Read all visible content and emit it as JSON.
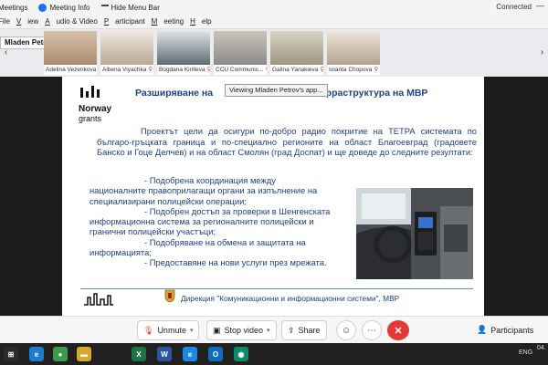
{
  "app": {
    "top_items": [
      {
        "label": "Meetings"
      },
      {
        "label": "Meeting Info"
      },
      {
        "label": "Hide Menu Bar"
      }
    ],
    "status": "Connected",
    "minimize": "—"
  },
  "menu": [
    {
      "label": "File",
      "underline_first": false
    },
    {
      "label": "View",
      "underline_first": true
    },
    {
      "label": "Audio & Video",
      "underline_first": true
    },
    {
      "label": "Participant",
      "underline_first": true
    },
    {
      "label": "Meeting",
      "underline_first": true
    },
    {
      "label": "Help",
      "underline_first": true
    }
  ],
  "presenter_label": "Mladen Petrov",
  "participants": [
    {
      "name": "Adelina Vezenkova",
      "color": "#c9b29a"
    },
    {
      "name": "Aibena Viyachka",
      "color": "#d8cfc3"
    },
    {
      "name": "Bogdana Kirilleva",
      "color": "#7c8a92"
    },
    {
      "name": "CCU Communic...",
      "color": "#b7b2a8"
    },
    {
      "name": "Galina Yanakieva",
      "color": "#c8c3b2"
    },
    {
      "name": "Iolanta Chopova",
      "color": "#d9ccbf"
    }
  ],
  "slide": {
    "title": "Разширяване на",
    "title_end": "инфраструктура на МВР",
    "tooltip": "Viewing Mladen Petrov's app...",
    "logo_line1": "Norway",
    "logo_line2": "grants",
    "intro": "Проектът цели да осигури по-добро радио покритие на ТЕТРА системата по българо-гръцката граница и по-специално регионите на област Благоевград (градовете Банско и Гоце Делчев) и на област Смолян (град Доспат) и ще доведе до следните резултати:",
    "bullets": [
      {
        "text": "- Подобрена координация между",
        "indent": true
      },
      {
        "text": "националните правоприлагащи органи за изпълнение на",
        "indent": false
      },
      {
        "text": "специализирани полицейски операции;",
        "indent": false
      },
      {
        "text": "- Подобрен достъп за проверки в Шенгенската",
        "indent": true
      },
      {
        "text": "информационна система за регионалните полицейски и",
        "indent": false
      },
      {
        "text": "гранични полицейски участъци;",
        "indent": false
      },
      {
        "text": "- Подобряване на обмена и защитата на",
        "indent": true
      },
      {
        "text": "информацията;",
        "indent": false
      },
      {
        "text": "- Предоставяне на нови услуги през мрежата.",
        "indent": true
      }
    ],
    "footer": "Дирекция \"Комуникационни и информационни системи\", МВР"
  },
  "controls": {
    "unmute": "Unmute",
    "stop_video": "Stop video",
    "share": "Share",
    "participants": "Participants"
  },
  "taskbar": {
    "apps": [
      {
        "name": "windows-start",
        "color": "#2a2a2a",
        "glyph": "⊞"
      },
      {
        "name": "search",
        "color": "#2a2a2a",
        "glyph": "⚲"
      },
      {
        "name": "edge",
        "color": "#1f7ad1",
        "glyph": "e"
      },
      {
        "name": "chrome",
        "color": "#3a9b4a",
        "glyph": "●"
      },
      {
        "name": "file-explorer",
        "color": "#d9a82a",
        "glyph": "▬"
      },
      {
        "name": "excel",
        "color": "#1f7245",
        "glyph": "X"
      },
      {
        "name": "word",
        "color": "#2b579a",
        "glyph": "W"
      },
      {
        "name": "ie",
        "color": "#1e88e5",
        "glyph": "e"
      },
      {
        "name": "outlook",
        "color": "#0f6cbd",
        "glyph": "O"
      },
      {
        "name": "webex",
        "color": "#0e8a6b",
        "glyph": "◉"
      }
    ],
    "lang": "ENG",
    "clock": "04."
  }
}
